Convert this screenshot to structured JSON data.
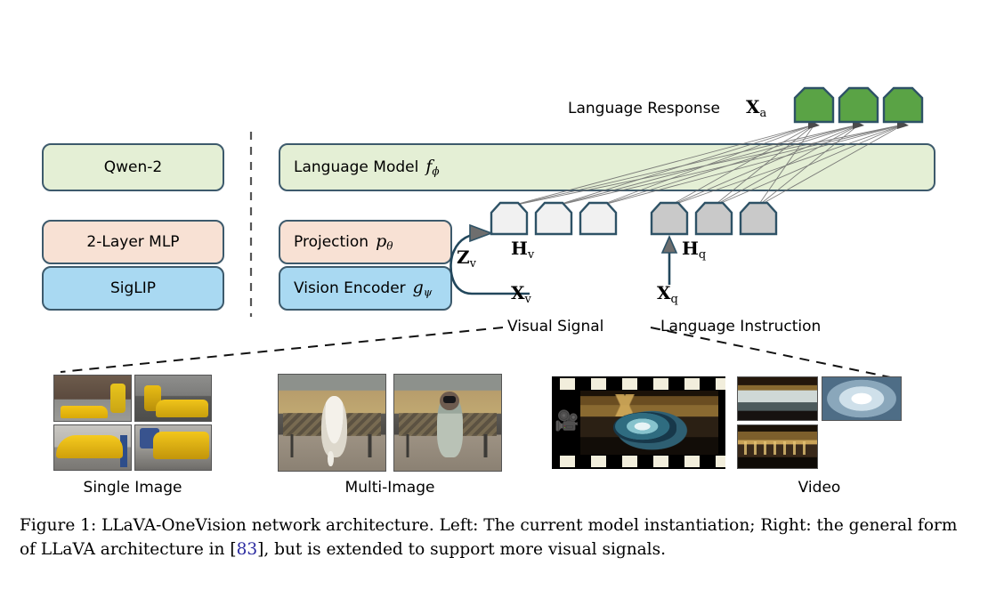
{
  "figure": {
    "left_stack": [
      {
        "id": "qwen2",
        "label": "Qwen-2",
        "color": "#e4efd5"
      },
      {
        "id": "mlp",
        "label": "2-Layer MLP",
        "color": "#f8e1d4"
      },
      {
        "id": "siglip",
        "label": "SigLIP",
        "color": "#a9d9f2"
      }
    ],
    "right_stack": [
      {
        "id": "language-model",
        "label": "Language Model",
        "symbol": "f",
        "subscript": "ϕ",
        "color": "#e4efd5"
      },
      {
        "id": "projection",
        "label": "Projection",
        "symbol": "p",
        "subscript": "θ",
        "color": "#f8e1d4"
      },
      {
        "id": "vision-encoder",
        "label": "Vision Encoder",
        "symbol": "g",
        "subscript": "ψ",
        "color": "#a9d9f2"
      }
    ],
    "labels": {
      "language_response": "Language Response",
      "x_a": "X",
      "x_a_sub": "a",
      "z_v": "Z",
      "z_v_sub": "v",
      "h_v": "H",
      "h_v_sub": "v",
      "x_v": "X",
      "x_v_sub": "v",
      "h_q": "H",
      "h_q_sub": "q",
      "x_q": "X",
      "x_q_sub": "q",
      "visual_signal": "Visual Signal",
      "language_instruction": "Language Instruction"
    },
    "tokens": {
      "response_count": 3,
      "response_color": "#5aa345",
      "visual_count": 3,
      "visual_color": "#f1f1f1",
      "query_count": 3,
      "query_color": "#c9c9c9",
      "border_color": "#2e5266"
    },
    "panels": [
      {
        "id": "single-image",
        "caption": "Single Image"
      },
      {
        "id": "multi-image",
        "caption": "Multi-Image"
      },
      {
        "id": "video",
        "caption": "Video"
      }
    ]
  },
  "caption": {
    "part1": "Figure 1: LLaVA-OneVision network architecture. Left: The current model instantiation; Right: the general form of LLaVA architecture in [",
    "ref": "83",
    "part2": "], but is extended to support more visual signals."
  }
}
